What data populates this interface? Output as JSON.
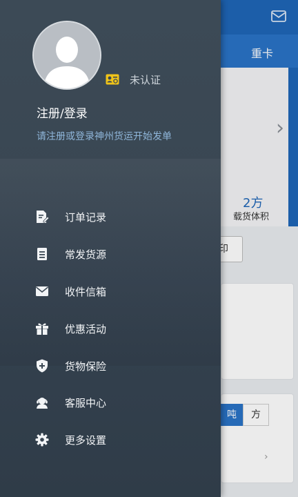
{
  "background": {
    "tab_label": "重卡",
    "volume_value": "2方",
    "volume_label": "载货体积",
    "button_text": "印",
    "unit_selected": "吨",
    "unit_other": "方",
    "mail_icon": "mail-icon",
    "colors": {
      "header": "#1f66b8",
      "accent": "#2a73c7"
    }
  },
  "drawer": {
    "avatar_icon": "default-avatar-icon",
    "verify_status": "未认证",
    "login_title": "注册/登录",
    "login_subtitle": "请注册或登录神州货运开始发单",
    "menu": [
      {
        "label": "订单记录",
        "icon": "order-record-icon"
      },
      {
        "label": "常发货源",
        "icon": "frequent-cargo-icon"
      },
      {
        "label": "收件信箱",
        "icon": "inbox-icon"
      },
      {
        "label": "优惠活动",
        "icon": "gift-icon"
      },
      {
        "label": "货物保险",
        "icon": "insurance-shield-icon"
      },
      {
        "label": "客服中心",
        "icon": "customer-service-icon"
      },
      {
        "label": "更多设置",
        "icon": "settings-gear-icon"
      }
    ],
    "colors": {
      "panel": "#3a4753",
      "subtitle": "#8fb6da",
      "badge": "#f0c419"
    }
  }
}
